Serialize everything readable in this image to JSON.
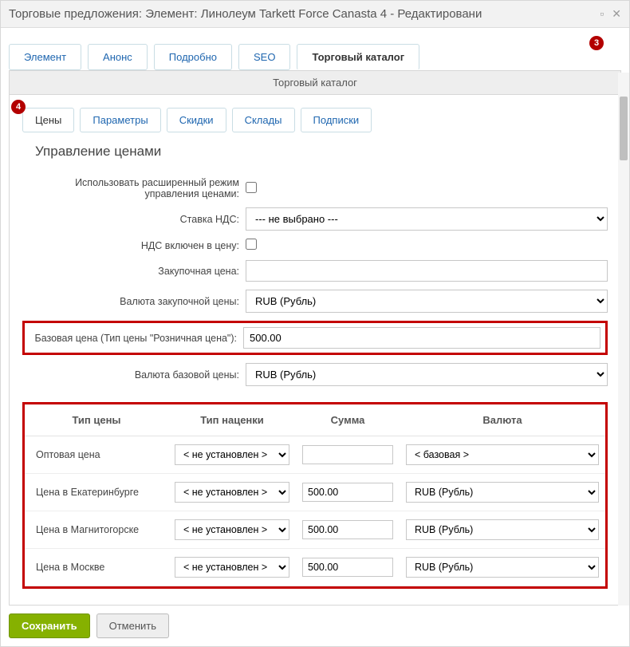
{
  "titlebar": {
    "title": "Торговые предложения: Элемент: Линолеум Tarkett Force Canasta 4 - Редактировани"
  },
  "outer_tabs": [
    {
      "label": "Элемент"
    },
    {
      "label": "Анонс"
    },
    {
      "label": "Подробно"
    },
    {
      "label": "SEO"
    },
    {
      "label": "Торговый каталог"
    }
  ],
  "badge3": "3",
  "badge4": "4",
  "panel_header": "Торговый каталог",
  "inner_tabs": [
    {
      "label": "Цены"
    },
    {
      "label": "Параметры"
    },
    {
      "label": "Скидки"
    },
    {
      "label": "Склады"
    },
    {
      "label": "Подписки"
    }
  ],
  "section_title": "Управление ценами",
  "form": {
    "ext_mode_label": "Использовать расширенный режим управления ценами:",
    "vat_rate_label": "Ставка НДС:",
    "vat_rate_value": "--- не выбрано ---",
    "vat_included_label": "НДС включен в цену:",
    "purchase_price_label": "Закупочная цена:",
    "purchase_price_value": "",
    "purchase_currency_label": "Валюта закупочной цены:",
    "purchase_currency_value": "RUB (Рубль)",
    "base_price_label": "Базовая цена (Тип цены \"Розничная цена\"):",
    "base_price_value": "500.00",
    "base_currency_label": "Валюта базовой цены:",
    "base_currency_value": "RUB (Рубль)"
  },
  "table": {
    "headers": {
      "type": "Тип цены",
      "markup": "Тип наценки",
      "sum": "Сумма",
      "currency": "Валюта"
    },
    "markup_default": "< не установлен >",
    "currency_rub": "RUB (Рубль)",
    "currency_base": "< базовая >",
    "rows": [
      {
        "type": "Оптовая цена",
        "sum": "",
        "currency": "< базовая >"
      },
      {
        "type": "Цена в Екатеринбурге",
        "sum": "500.00",
        "currency": "RUB (Рубль)"
      },
      {
        "type": "Цена в Магнитогорске",
        "sum": "500.00",
        "currency": "RUB (Рубль)"
      },
      {
        "type": "Цена в Москве",
        "sum": "500.00",
        "currency": "RUB (Рубль)"
      }
    ]
  },
  "buttons": {
    "save": "Сохранить",
    "cancel": "Отменить"
  }
}
